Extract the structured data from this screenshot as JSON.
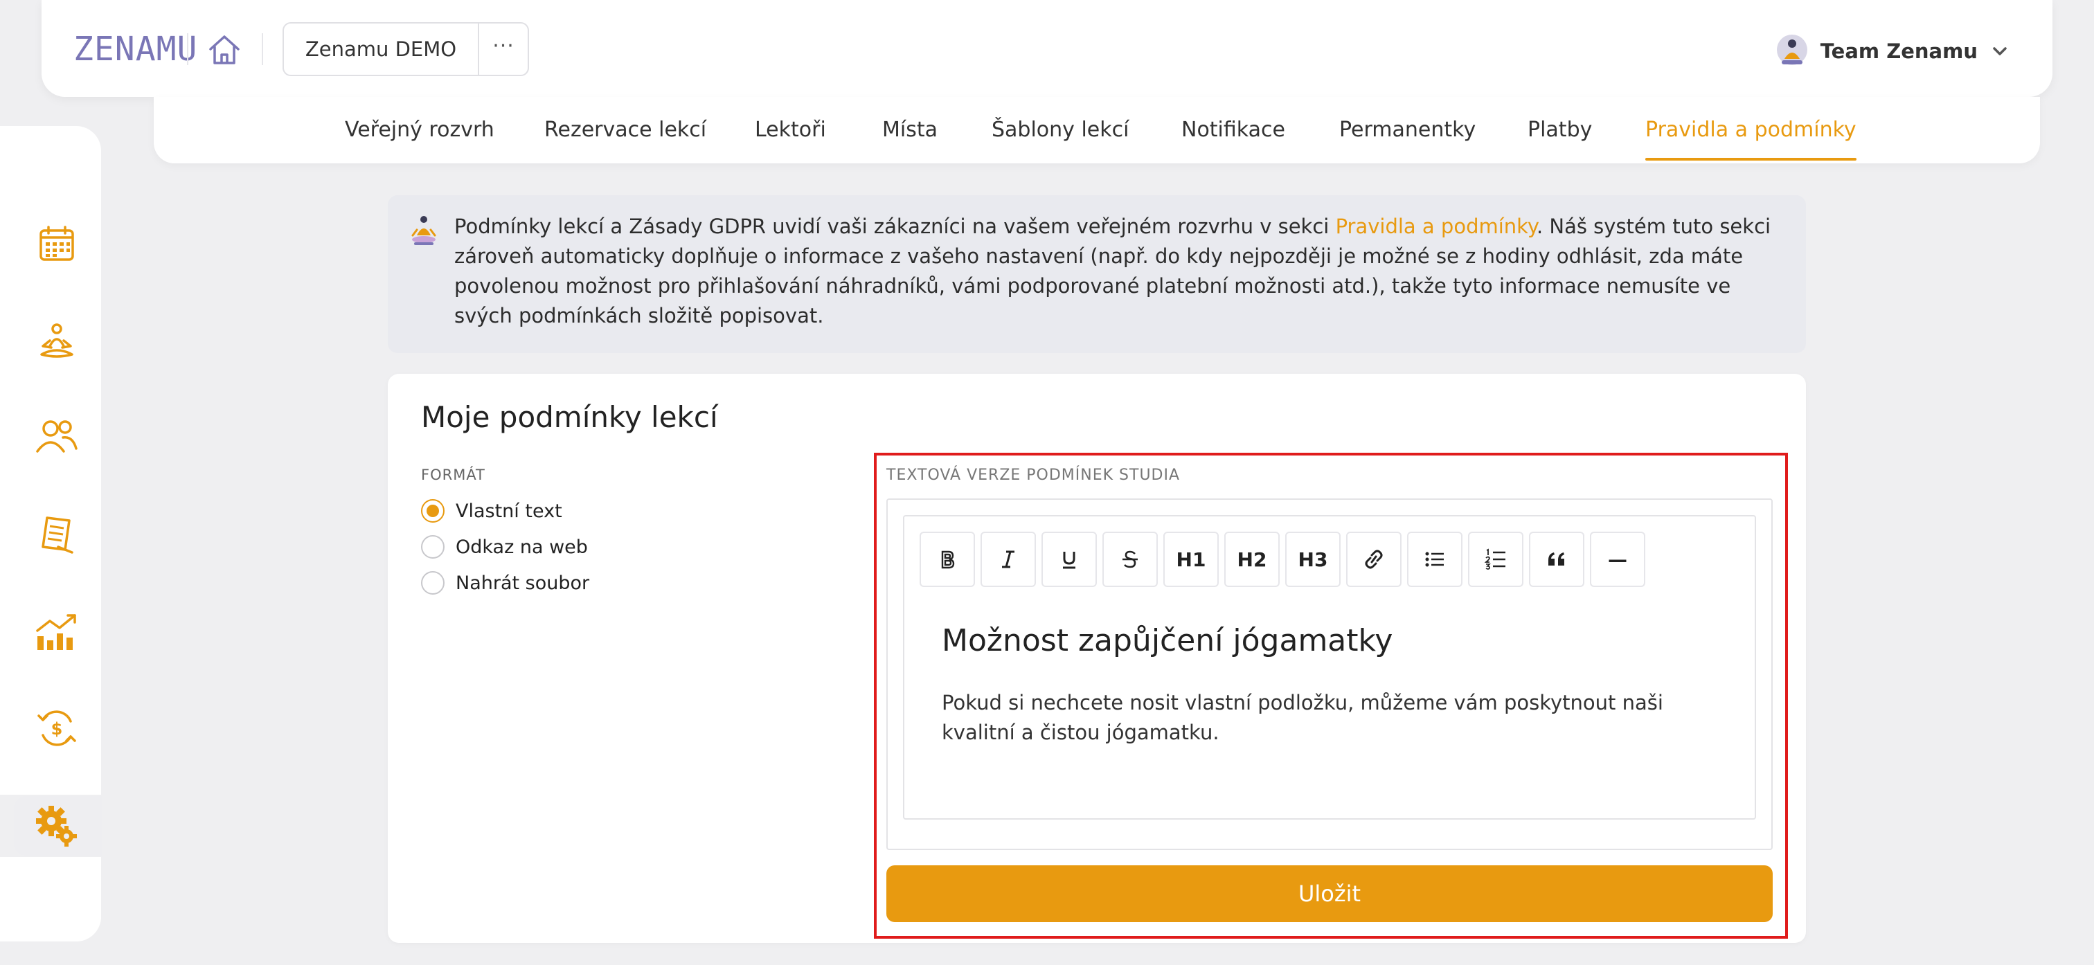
{
  "header": {
    "logo": "ZENAMU",
    "studio_name": "Zenamu DEMO",
    "more_label": "···",
    "team_name": "Team Zenamu"
  },
  "tabs": [
    {
      "label": "Veřejný rozvrh"
    },
    {
      "label": "Rezervace lekcí"
    },
    {
      "label": "Lektoři"
    },
    {
      "label": "Místa"
    },
    {
      "label": "Šablony lekcí"
    },
    {
      "label": "Notifikace"
    },
    {
      "label": "Permanentky"
    },
    {
      "label": "Platby"
    },
    {
      "label": "Pravidla a podmínky",
      "active": true
    }
  ],
  "sidebar": {
    "icons": [
      "calendar-icon",
      "meditation-icon",
      "users-icon",
      "document-icon",
      "chart-icon",
      "payment-icon",
      "settings-icon"
    ],
    "active": "settings-icon"
  },
  "info": {
    "text_before": "Podmínky lekcí a Zásady GDPR uvidí vaši zákazníci na vašem veřejném rozvrhu v sekci ",
    "link": "Pravidla a podmínky",
    "text_after": ". Náš systém tuto sekci zároveň automaticky doplňuje o informace z vašeho nastavení (např. do kdy nejpozději je možné se z hodiny odhlásit, zda máte povolenou možnost pro přihlašování náhradníků, vámi podporované platební možnosti atd.), takže tyto informace nemusíte ve svých podmínkách složitě popisovat."
  },
  "card": {
    "title": "Moje podmínky lekcí",
    "format_label": "FORMÁT",
    "format_options": [
      {
        "label": "Vlastní text",
        "checked": true
      },
      {
        "label": "Odkaz na web",
        "checked": false
      },
      {
        "label": "Nahrát soubor",
        "checked": false
      }
    ]
  },
  "editor": {
    "label": "TEXTOVÁ VERZE PODMÍNEK STUDIA",
    "toolbar": {
      "h1": "H1",
      "h2": "H2",
      "h3": "H3",
      "hr": "—"
    },
    "heading": "Možnost zapůjčení jógamatky",
    "paragraph": "Pokud si nechcete nosit vlastní podložku, můžeme vám poskytnout naši kvalitní a čistou jógamatku."
  },
  "save_label": "Uložit",
  "colors": {
    "accent": "#e89a10",
    "highlight": "#e01c1c",
    "logo": "#7a76b6"
  }
}
